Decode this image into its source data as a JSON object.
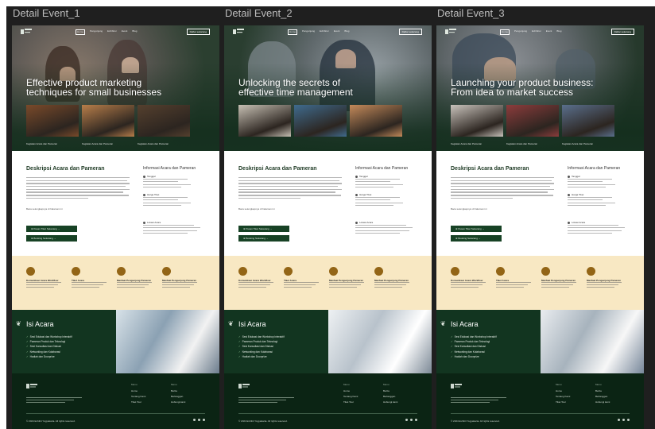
{
  "frames": [
    {
      "frame_title": "Detail Event_1",
      "hero_title": [
        "Effective product marketing",
        "techniques for small businesses"
      ],
      "thumb_captions": [
        "Kegiatan Acara dan Pameran",
        "Kegiatan Acara dan Pameran",
        "Kegiatan Acara dan Pameran"
      ]
    },
    {
      "frame_title": "Detail Event_2",
      "hero_title": [
        "Unlocking the secrets of",
        "effective time management"
      ],
      "thumb_captions": [
        "",
        "",
        ""
      ]
    },
    {
      "frame_title": "Detail Event_3",
      "hero_title": [
        "Launching your product business:",
        "From idea to market success"
      ],
      "thumb_captions": [
        "Kegiatan Acara dan Pameran",
        "Kegiatan Acara dan Pameran",
        "Kegiatan Acara dan Pameran"
      ]
    }
  ],
  "common": {
    "nav_links": [
      "Home",
      "Pengunjung",
      "Exhibitor",
      "Event",
      "Blog"
    ],
    "nav_cta": "Daftar sekarang",
    "desc_title": "Deskripsi Acara dan Pameran",
    "desc_link": "Baca selengkapnya di halaman ini",
    "btn_primary": "Pesan Tiket Sekarang",
    "btn_secondary": "Booking Sekarang",
    "info_title": "Informasi Acara dan Pameran",
    "info_labels": [
      "Tanggal",
      "Harga Tiket",
      "Lokasi Acara"
    ],
    "features": [
      "Komunikasi Acara Workflow",
      "Tiket Acara",
      "Manfaat Pengunjung Pameran",
      "Manfaat Pengunjung Pameran"
    ],
    "isi_title": "Isi Acara",
    "isi_items": [
      "Sesi Edukasi dan Workshop Interaktif",
      "Pameran Produk dan Teknologi",
      "Sesi Konsultasi dan Diskusi",
      "Networking dan Kolaborasi",
      "Hadiah dan Doorprize"
    ],
    "footer_col1_title": "Menu",
    "footer_col1": [
      "Home",
      "Tentang Kami",
      "Tiket Tour"
    ],
    "footer_col2_title": "Menu",
    "footer_col2": [
      "Berita",
      "Berlanggan",
      "Hubungi kami"
    ],
    "copyright": "© 2024 Exhibit Yogyakarta. All rights reserved."
  },
  "colors": {
    "canvas": "#1f1f1f",
    "brand_green": "#174225",
    "dark_green": "#123520",
    "footer_green": "#0b2414",
    "cream": "#f8e8c3",
    "gold": "#936516"
  }
}
